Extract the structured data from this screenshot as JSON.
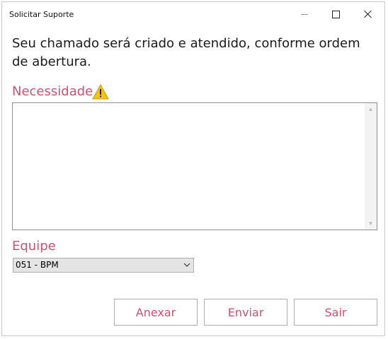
{
  "window": {
    "title": "Solicitar Suporte"
  },
  "message": "Seu chamado será criado e atendido, conforme ordem de abertura.",
  "necessity": {
    "label": "Necessidade",
    "value": "",
    "icon": "warning-icon"
  },
  "team": {
    "label": "Equipe",
    "selected": "051 - BPM"
  },
  "buttons": {
    "attach": "Anexar",
    "send": "Enviar",
    "exit": "Sair"
  },
  "colors": {
    "accent": "#d0506e",
    "warning": "#f5c400"
  }
}
